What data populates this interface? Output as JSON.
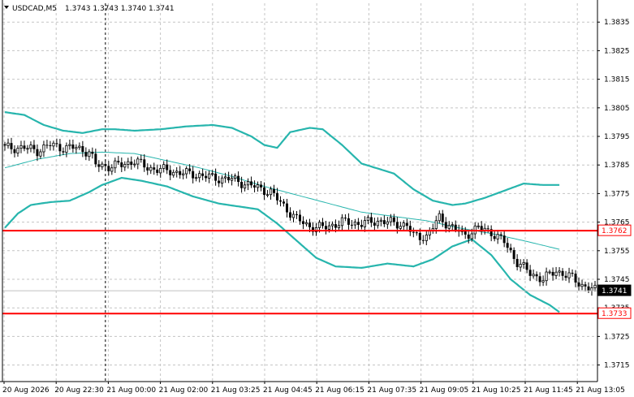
{
  "header": {
    "symbol_label": "USDCAD,M5",
    "ohlc": "1.3743 1.3743 1.3740 1.3741"
  },
  "colors": {
    "grid": "#c4c4c4",
    "band": "#27b5ad",
    "level": "#ff0000",
    "candle": "#000000",
    "bid_line": "#c0c0c0",
    "tag_dark": "#000000"
  },
  "chart_data": {
    "type": "candlestick",
    "y_ticks": [
      "1.3835",
      "1.3825",
      "1.3815",
      "1.3805",
      "1.3795",
      "1.3785",
      "1.3775",
      "1.3765",
      "1.3755",
      "1.3745",
      "1.3735",
      "1.3725",
      "1.3715"
    ],
    "x_ticks": [
      "20 Aug 2026",
      "20 Aug 22:30",
      "21 Aug 00:00",
      "21 Aug 02:00",
      "21 Aug 03:25",
      "21 Aug 04:45",
      "21 Aug 06:15",
      "21 Aug 07:35",
      "21 Aug 09:05",
      "21 Aug 10:25",
      "21 Aug 11:45",
      "21 Aug 13:05"
    ],
    "ylim": [
      1.37092,
      1.38416
    ],
    "n_bars": 183,
    "price_labels": [
      {
        "text": "1.3762",
        "value": 1.3762,
        "style": "level"
      },
      {
        "text": "1.3741",
        "value": 1.3741,
        "style": "bid"
      },
      {
        "text": "1.3733",
        "value": 1.3733,
        "style": "level"
      }
    ],
    "horizontal_levels": [
      1.3762,
      1.3733
    ],
    "bid_line": 1.3741,
    "vline_bar": 31,
    "bollinger_upper": [
      [
        0,
        1.38035
      ],
      [
        6,
        1.38025
      ],
      [
        12,
        1.3799
      ],
      [
        18,
        1.3797
      ],
      [
        24,
        1.37962
      ],
      [
        30,
        1.37975
      ],
      [
        34,
        1.37975
      ],
      [
        40,
        1.3797
      ],
      [
        48,
        1.37975
      ],
      [
        56,
        1.37985
      ],
      [
        64,
        1.3799
      ],
      [
        70,
        1.3798
      ],
      [
        76,
        1.3795
      ],
      [
        80,
        1.3792
      ],
      [
        84,
        1.3791
      ],
      [
        88,
        1.37965
      ],
      [
        94,
        1.3798
      ],
      [
        98,
        1.37975
      ],
      [
        104,
        1.3792
      ],
      [
        110,
        1.37855
      ],
      [
        120,
        1.3782
      ],
      [
        126,
        1.37765
      ],
      [
        132,
        1.37725
      ],
      [
        138,
        1.3771
      ],
      [
        142,
        1.37715
      ],
      [
        148,
        1.37735
      ],
      [
        154,
        1.3776
      ],
      [
        160,
        1.37785
      ],
      [
        166,
        1.3778
      ],
      [
        171,
        1.3778
      ]
    ],
    "bollinger_middle": [
      [
        0,
        1.3784
      ],
      [
        10,
        1.3787
      ],
      [
        20,
        1.3789
      ],
      [
        30,
        1.37895
      ],
      [
        40,
        1.3789
      ],
      [
        50,
        1.37865
      ],
      [
        60,
        1.3784
      ],
      [
        70,
        1.3781
      ],
      [
        80,
        1.37775
      ],
      [
        90,
        1.37745
      ],
      [
        100,
        1.37715
      ],
      [
        110,
        1.37685
      ],
      [
        120,
        1.3767
      ],
      [
        130,
        1.37655
      ],
      [
        140,
        1.3763
      ],
      [
        150,
        1.3761
      ],
      [
        160,
        1.37585
      ],
      [
        171,
        1.37555
      ]
    ],
    "bollinger_lower": [
      [
        0,
        1.3763
      ],
      [
        4,
        1.3768
      ],
      [
        8,
        1.3771
      ],
      [
        14,
        1.3772
      ],
      [
        20,
        1.37725
      ],
      [
        26,
        1.37755
      ],
      [
        30,
        1.3778
      ],
      [
        36,
        1.37805
      ],
      [
        42,
        1.37795
      ],
      [
        50,
        1.37775
      ],
      [
        58,
        1.3774
      ],
      [
        66,
        1.37715
      ],
      [
        72,
        1.37705
      ],
      [
        78,
        1.37695
      ],
      [
        84,
        1.37645
      ],
      [
        90,
        1.37585
      ],
      [
        96,
        1.37525
      ],
      [
        102,
        1.37495
      ],
      [
        110,
        1.3749
      ],
      [
        118,
        1.37505
      ],
      [
        126,
        1.37495
      ],
      [
        132,
        1.3752
      ],
      [
        138,
        1.37565
      ],
      [
        144,
        1.3759
      ],
      [
        150,
        1.37535
      ],
      [
        156,
        1.3745
      ],
      [
        162,
        1.37395
      ],
      [
        168,
        1.3736
      ],
      [
        171,
        1.37335
      ]
    ],
    "close_anchors": [
      [
        0,
        1.3791
      ],
      [
        6,
        1.3791
      ],
      [
        10,
        1.379
      ],
      [
        14,
        1.3792
      ],
      [
        18,
        1.3791
      ],
      [
        22,
        1.3791
      ],
      [
        26,
        1.37895
      ],
      [
        28,
        1.3785
      ],
      [
        32,
        1.37845
      ],
      [
        36,
        1.3785
      ],
      [
        40,
        1.37865
      ],
      [
        44,
        1.3784
      ],
      [
        50,
        1.3783
      ],
      [
        56,
        1.3782
      ],
      [
        60,
        1.37815
      ],
      [
        64,
        1.37805
      ],
      [
        70,
        1.378
      ],
      [
        74,
        1.37785
      ],
      [
        78,
        1.3777
      ],
      [
        82,
        1.37755
      ],
      [
        84,
        1.3773
      ],
      [
        90,
        1.3766
      ],
      [
        94,
        1.37635
      ],
      [
        98,
        1.3763
      ],
      [
        104,
        1.3765
      ],
      [
        110,
        1.37645
      ],
      [
        116,
        1.37655
      ],
      [
        120,
        1.37645
      ],
      [
        124,
        1.3764
      ],
      [
        126,
        1.376
      ],
      [
        130,
        1.376
      ],
      [
        134,
        1.37665
      ],
      [
        138,
        1.3763
      ],
      [
        142,
        1.37605
      ],
      [
        146,
        1.3763
      ],
      [
        150,
        1.37615
      ],
      [
        154,
        1.3758
      ],
      [
        158,
        1.3751
      ],
      [
        162,
        1.3747
      ],
      [
        166,
        1.3745
      ],
      [
        170,
        1.3748
      ],
      [
        174,
        1.3746
      ],
      [
        178,
        1.3743
      ],
      [
        182,
        1.3741
      ]
    ]
  }
}
